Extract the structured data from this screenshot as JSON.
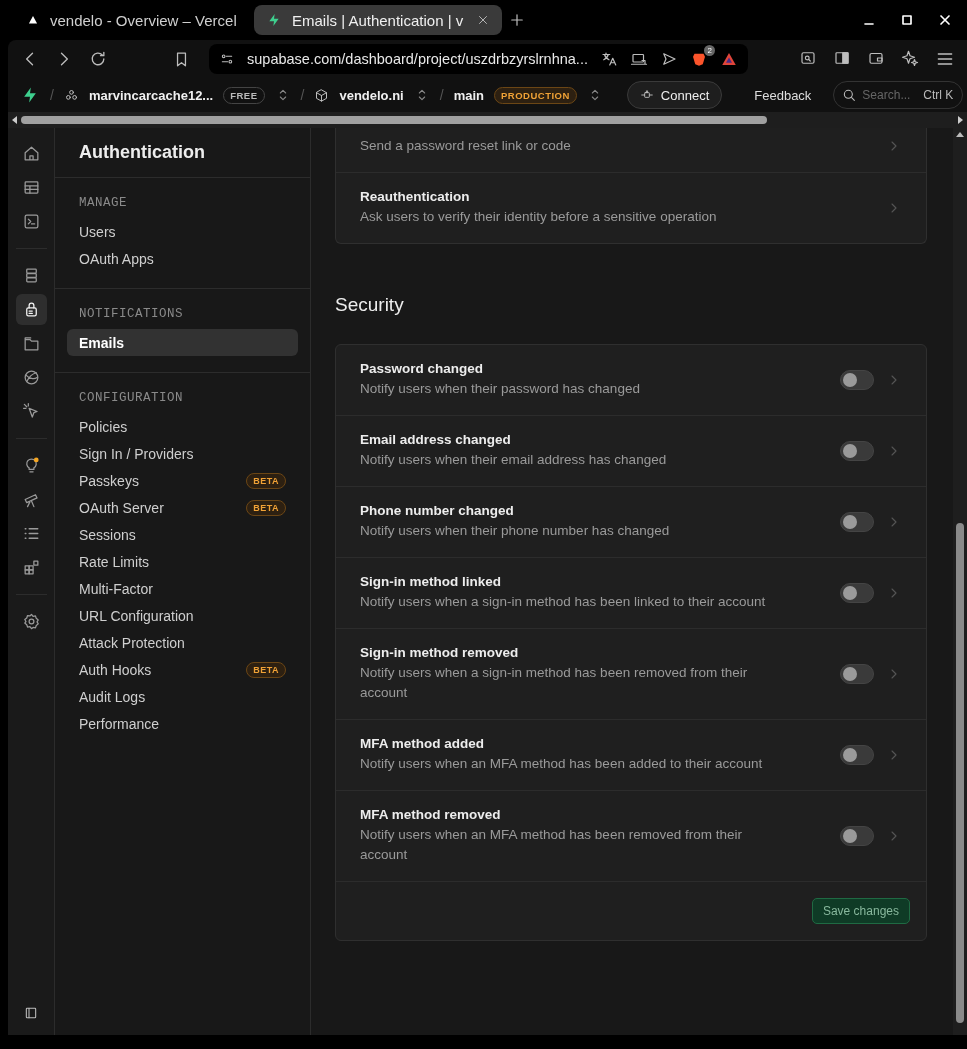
{
  "browser": {
    "tabs": [
      {
        "title": "vendelo - Overview – Vercel",
        "selected": false
      },
      {
        "title": "Emails | Authentication | v",
        "selected": true
      }
    ],
    "address": "supabase.com/dashboard/project/uszdrbzyrslrnhna...",
    "extension_badge": "2"
  },
  "header": {
    "separator": "/",
    "org": "marvincarcache12...",
    "plan": "FREE",
    "project": "vendelo.ni",
    "branch": "main",
    "environment": "PRODUCTION",
    "connect": "Connect",
    "feedback": "Feedback",
    "search": {
      "placeholder": "Search...",
      "shortcut": "Ctrl K"
    }
  },
  "rail": [
    {
      "selected": false
    },
    {
      "selected": false
    },
    {
      "selected": false
    },
    {
      "selected": false
    },
    {
      "selected": true
    },
    {
      "selected": false
    },
    {
      "selected": false
    },
    {
      "selected": false
    },
    {
      "selected": false
    },
    {
      "selected": false
    },
    {
      "selected": false
    },
    {
      "selected": false
    },
    {
      "selected": false
    }
  ],
  "sidebar": {
    "title": "Authentication",
    "sections": [
      {
        "heading": "MANAGE",
        "items": [
          {
            "label": "Users",
            "selected": false
          },
          {
            "label": "OAuth Apps",
            "selected": false
          }
        ]
      },
      {
        "heading": "NOTIFICATIONS",
        "items": [
          {
            "label": "Emails",
            "selected": true
          }
        ]
      },
      {
        "heading": "CONFIGURATION",
        "items": [
          {
            "label": "Policies",
            "selected": false
          },
          {
            "label": "Sign In / Providers",
            "selected": false
          },
          {
            "label": "Passkeys",
            "selected": false,
            "badge": "BETA"
          },
          {
            "label": "OAuth Server",
            "selected": false,
            "badge": "BETA"
          },
          {
            "label": "Sessions",
            "selected": false
          },
          {
            "label": "Rate Limits",
            "selected": false
          },
          {
            "label": "Multi-Factor",
            "selected": false
          },
          {
            "label": "URL Configuration",
            "selected": false
          },
          {
            "label": "Attack Protection",
            "selected": false
          },
          {
            "label": "Auth Hooks",
            "selected": false,
            "badge": "BETA"
          },
          {
            "label": "Audit Logs",
            "selected": false
          },
          {
            "label": "Performance",
            "selected": false
          }
        ]
      }
    ]
  },
  "content": {
    "top_rows": [
      {
        "description": "Send a password reset link or code"
      },
      {
        "title": "Reauthentication",
        "description": "Ask users to verify their identity before a sensitive operation"
      }
    ],
    "security": {
      "heading": "Security",
      "rows": [
        {
          "title": "Password changed",
          "description": "Notify users when their password has changed",
          "on": false
        },
        {
          "title": "Email address changed",
          "description": "Notify users when their email address has changed",
          "on": false
        },
        {
          "title": "Phone number changed",
          "description": "Notify users when their phone number has changed",
          "on": false
        },
        {
          "title": "Sign-in method linked",
          "description": "Notify users when a sign-in method has been linked to their account",
          "on": false
        },
        {
          "title": "Sign-in method removed",
          "description": "Notify users when a sign-in method has been removed from their account",
          "on": false
        },
        {
          "title": "MFA method added",
          "description": "Notify users when an MFA method has been added to their account",
          "on": false
        },
        {
          "title": "MFA method removed",
          "description": "Notify users when an MFA method has been removed from their account",
          "on": false
        }
      ],
      "save": "Save changes"
    }
  }
}
